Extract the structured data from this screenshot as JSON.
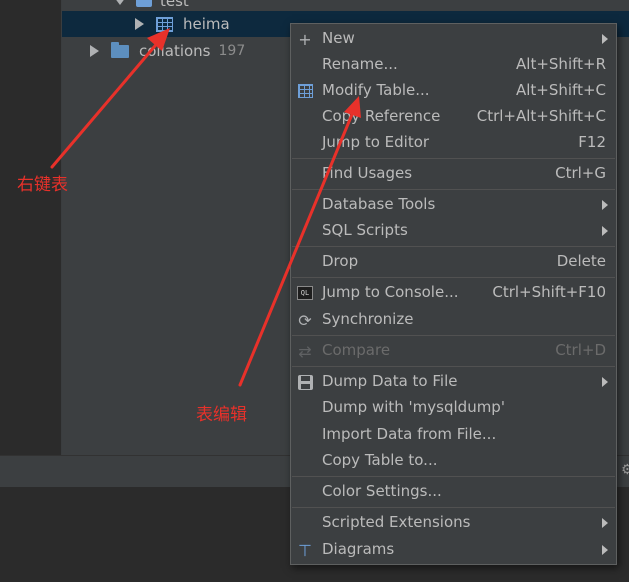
{
  "tree": {
    "top_item": "test",
    "heima": "heima",
    "collations": "collations",
    "collations_count": "197"
  },
  "menu": {
    "items": [
      {
        "label": "New",
        "shortcut": "",
        "submenu": true,
        "icon": "plus-icon"
      },
      {
        "label": "Rename...",
        "shortcut": "Alt+Shift+R",
        "submenu": false,
        "icon": ""
      },
      {
        "label": "Modify Table...",
        "shortcut": "Alt+Shift+C",
        "submenu": false,
        "icon": "table-icon"
      },
      {
        "label": "Copy Reference",
        "shortcut": "Ctrl+Alt+Shift+C",
        "submenu": false,
        "icon": ""
      },
      {
        "label": "Jump to Editor",
        "shortcut": "F12",
        "submenu": false,
        "icon": ""
      },
      {
        "label": "Find Usages",
        "shortcut": "Ctrl+G",
        "submenu": false,
        "icon": ""
      },
      {
        "label": "Database Tools",
        "shortcut": "",
        "submenu": true,
        "icon": ""
      },
      {
        "label": "SQL Scripts",
        "shortcut": "",
        "submenu": true,
        "icon": ""
      },
      {
        "label": "Drop",
        "shortcut": "Delete",
        "submenu": false,
        "icon": ""
      },
      {
        "label": "Jump to Console...",
        "shortcut": "Ctrl+Shift+F10",
        "submenu": false,
        "icon": "console-icon"
      },
      {
        "label": "Synchronize",
        "shortcut": "",
        "submenu": false,
        "icon": "sync-icon"
      },
      {
        "label": "Compare",
        "shortcut": "Ctrl+D",
        "submenu": false,
        "icon": "compare-icon",
        "disabled": true
      },
      {
        "label": "Dump Data to File",
        "shortcut": "",
        "submenu": true,
        "icon": "save-icon"
      },
      {
        "label": "Dump with 'mysqldump'",
        "shortcut": "",
        "submenu": false,
        "icon": ""
      },
      {
        "label": "Import Data from File...",
        "shortcut": "",
        "submenu": false,
        "icon": ""
      },
      {
        "label": "Copy Table to...",
        "shortcut": "",
        "submenu": false,
        "icon": ""
      },
      {
        "label": "Color Settings...",
        "shortcut": "",
        "submenu": false,
        "icon": ""
      },
      {
        "label": "Scripted Extensions",
        "shortcut": "",
        "submenu": true,
        "icon": ""
      },
      {
        "label": "Diagrams",
        "shortcut": "",
        "submenu": true,
        "icon": "diagram-icon"
      }
    ],
    "console_icon_text": "QL"
  },
  "annotations": {
    "right_click_table": "右键表",
    "table_edit": "表编辑"
  },
  "colors": {
    "annotation": "#e8312a",
    "selection": "#0d293e",
    "menu_bg": "#3c3f41"
  }
}
